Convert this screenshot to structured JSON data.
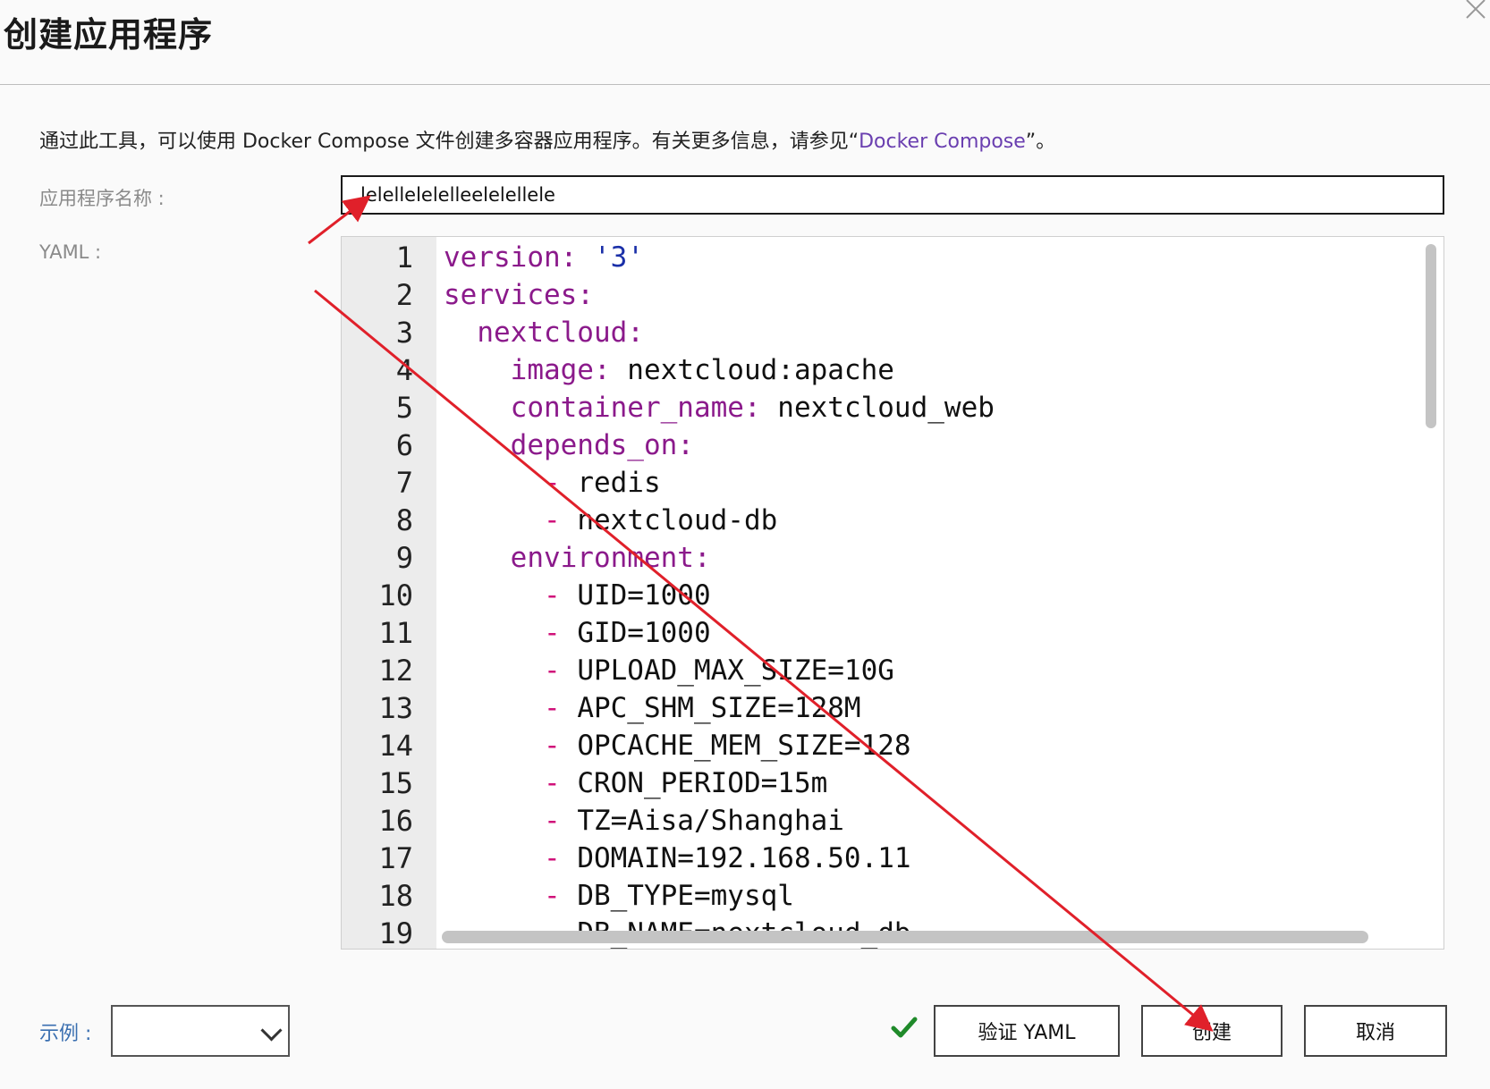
{
  "dialog": {
    "title": "创建应用程序",
    "intro_text": "通过此工具，可以使用 Docker Compose 文件创建多容器应用程序。有关更多信息，请参见“",
    "intro_link": "Docker Compose",
    "intro_suffix": "”。"
  },
  "form": {
    "name_label": "应用程序名称 :",
    "name_value": "lelellelelelleelelellele",
    "yaml_label": "YAML :"
  },
  "editor": {
    "line_numbers": [
      "1",
      "2",
      "3",
      "4",
      "5",
      "6",
      "7",
      "8",
      "9",
      "10",
      "11",
      "12",
      "13",
      "14",
      "15",
      "16",
      "17",
      "18",
      "19"
    ],
    "lines": [
      {
        "indent": "",
        "key": "version:",
        "value": " '3'",
        "value_type": "string"
      },
      {
        "indent": "",
        "key": "services:",
        "value": "",
        "value_type": "plain"
      },
      {
        "indent": "  ",
        "key": "nextcloud:",
        "value": "",
        "value_type": "plain"
      },
      {
        "indent": "    ",
        "key": "image:",
        "value": " nextcloud:apache",
        "value_type": "plain"
      },
      {
        "indent": "    ",
        "key": "container_name:",
        "value": " nextcloud_web",
        "value_type": "plain"
      },
      {
        "indent": "    ",
        "key": "depends_on:",
        "value": "",
        "value_type": "plain"
      },
      {
        "indent": "      ",
        "dash": "-",
        "value": " redis",
        "value_type": "plain"
      },
      {
        "indent": "      ",
        "dash": "-",
        "value": " nextcloud-db",
        "value_type": "plain"
      },
      {
        "indent": "    ",
        "key": "environment:",
        "value": "",
        "value_type": "plain"
      },
      {
        "indent": "      ",
        "dash": "-",
        "value": " UID=1000",
        "value_type": "plain"
      },
      {
        "indent": "      ",
        "dash": "-",
        "value": " GID=1000",
        "value_type": "plain"
      },
      {
        "indent": "      ",
        "dash": "-",
        "value": " UPLOAD_MAX_SIZE=10G",
        "value_type": "plain"
      },
      {
        "indent": "      ",
        "dash": "-",
        "value": " APC_SHM_SIZE=128M",
        "value_type": "plain"
      },
      {
        "indent": "      ",
        "dash": "-",
        "value": " OPCACHE_MEM_SIZE=128",
        "value_type": "plain"
      },
      {
        "indent": "      ",
        "dash": "-",
        "value": " CRON_PERIOD=15m",
        "value_type": "plain"
      },
      {
        "indent": "      ",
        "dash": "-",
        "value": " TZ=Aisa/Shanghai",
        "value_type": "plain"
      },
      {
        "indent": "      ",
        "dash": "-",
        "value": " DOMAIN=192.168.50.11",
        "value_type": "plain"
      },
      {
        "indent": "      ",
        "dash": "-",
        "value": " DB_TYPE=mysql",
        "value_type": "plain"
      },
      {
        "indent": "      ",
        "dash": "-",
        "value": " DB_NAME=nextcloud_db",
        "value_type": "plain"
      }
    ]
  },
  "footer": {
    "example_label": "示例 :",
    "example_value": "",
    "validate_button": "验证 YAML",
    "create_button": "创建",
    "cancel_button": "取消"
  },
  "colors": {
    "key": "#8b1a8b",
    "string": "#1a2fa8",
    "dash": "#d0127a",
    "annotation": "#e0202a",
    "check": "#1f8a2a"
  }
}
